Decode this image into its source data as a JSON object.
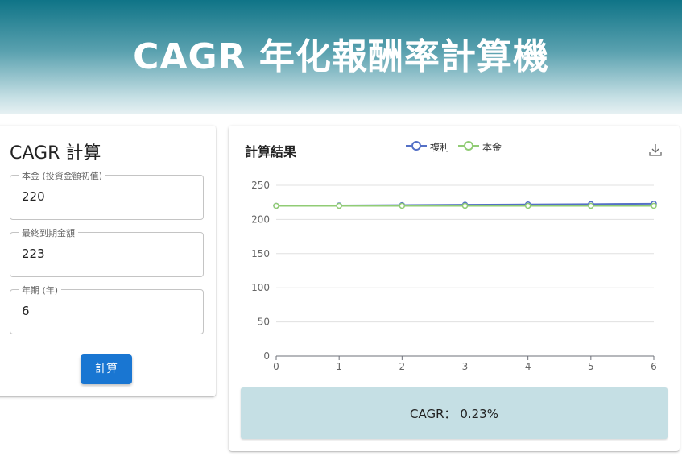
{
  "header": {
    "title": "CAGR 年化報酬率計算機"
  },
  "form": {
    "title": "CAGR 計算",
    "fields": [
      {
        "label": "本金 (投資金額初值)",
        "value": "220"
      },
      {
        "label": "最終到期金額",
        "value": "223"
      },
      {
        "label": "年期 (年)",
        "value": "6"
      }
    ],
    "submit_label": "計算"
  },
  "results": {
    "title": "計算結果",
    "download_icon": "download-icon",
    "cagr_label": "CAGR：",
    "cagr_value": "0.23%"
  },
  "chart_data": {
    "type": "line",
    "x": [
      0,
      1,
      2,
      3,
      4,
      5,
      6
    ],
    "series": [
      {
        "name": "複利",
        "color": "#5470c6",
        "values": [
          220,
          220.5,
          221.0,
          221.5,
          222.0,
          222.5,
          223.0
        ]
      },
      {
        "name": "本金",
        "color": "#91cc75",
        "values": [
          220,
          220,
          220,
          220,
          220,
          220,
          220
        ]
      }
    ],
    "xticks": [
      "0",
      "1",
      "2",
      "3",
      "4",
      "5",
      "6"
    ],
    "yticks": [
      "0",
      "50",
      "100",
      "150",
      "200",
      "250"
    ],
    "ylim": [
      0,
      250
    ],
    "grid": true,
    "legend": "top-center"
  }
}
